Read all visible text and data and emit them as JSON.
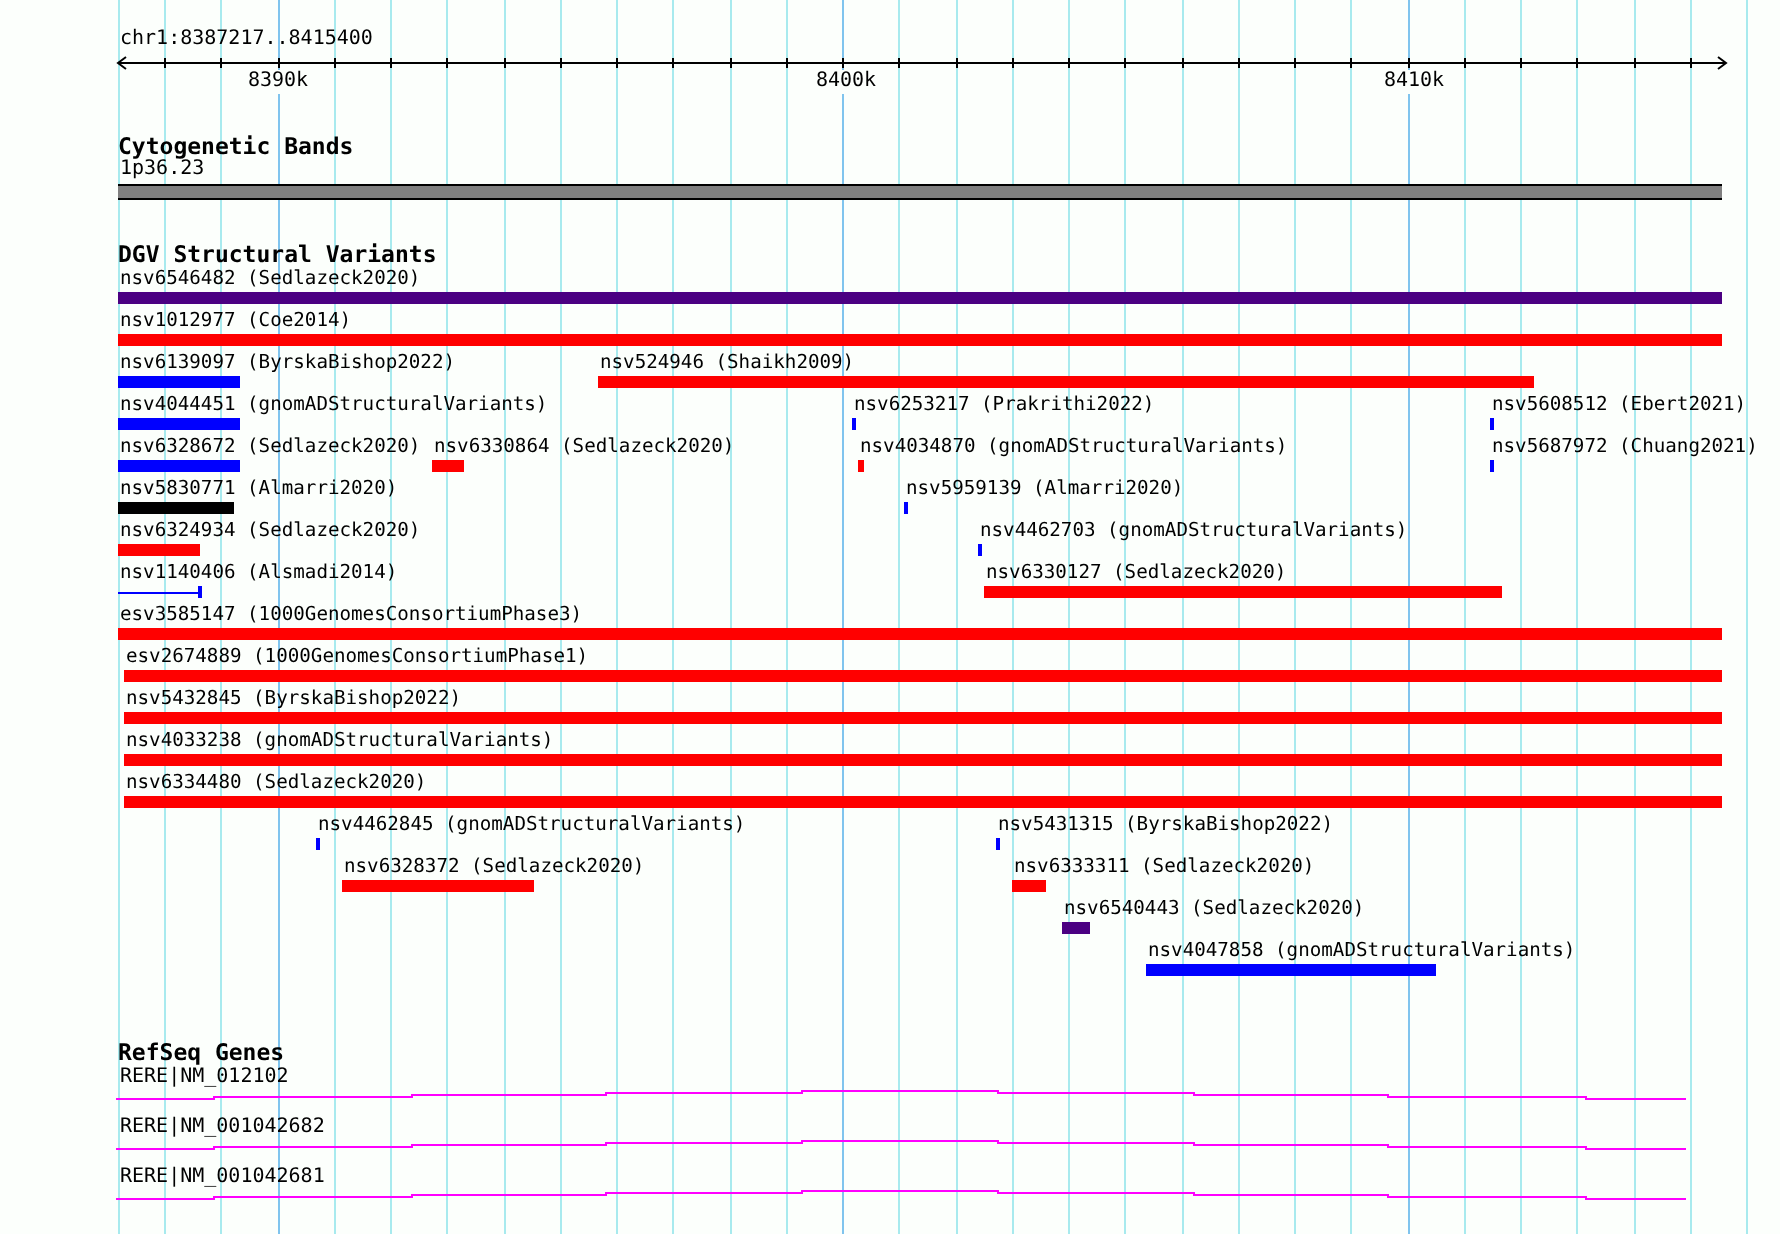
{
  "axis": {
    "location": "chr1:8387217..8415400",
    "ticks": [
      "8390k",
      "8400k",
      "8410k"
    ]
  },
  "tracks": [
    {
      "kind": "bands",
      "title": "Cytogenetic Bands",
      "features": [
        {
          "label": "1p36.23",
          "color": "#808080"
        }
      ]
    },
    {
      "kind": "variants",
      "title": "DGV Structural Variants",
      "features": [
        {
          "label": "nsv6546482 (Sedlazeck2020)",
          "color": "#4b0082",
          "kind": "bar"
        },
        {
          "label": "nsv1012977 (Coe2014)",
          "color": "#ff0000",
          "kind": "bar"
        },
        {
          "label": "nsv6139097 (ByrskaBishop2022)",
          "color": "#0000ff",
          "kind": "bar"
        },
        {
          "label": "nsv524946 (Shaikh2009)",
          "color": "#ff0000",
          "kind": "bar"
        },
        {
          "label": "nsv4044451 (gnomADStructuralVariants)",
          "color": "#0000ff",
          "kind": "bar"
        },
        {
          "label": "nsv6253217 (Prakrithi2022)",
          "color": "#0000ff",
          "kind": "bar"
        },
        {
          "label": "nsv5608512 (Ebert2021)",
          "color": "#0000ff",
          "kind": "bar"
        },
        {
          "label": "nsv6328672 (Sedlazeck2020)",
          "color": "#0000ff",
          "kind": "bar"
        },
        {
          "label": "nsv6330864 (Sedlazeck2020)",
          "color": "#ff0000",
          "kind": "bar"
        },
        {
          "label": "nsv4034870 (gnomADStructuralVariants)",
          "color": "#ff0000",
          "kind": "bar"
        },
        {
          "label": "nsv5687972 (Chuang2021)",
          "color": "#0000ff",
          "kind": "bar"
        },
        {
          "label": "nsv5830771 (Almarri2020)",
          "color": "#000000",
          "kind": "bar"
        },
        {
          "label": "nsv5959139 (Almarri2020)",
          "color": "#0000ff",
          "kind": "bar"
        },
        {
          "label": "nsv6324934 (Sedlazeck2020)",
          "color": "#ff0000",
          "kind": "bar"
        },
        {
          "label": "nsv4462703 (gnomADStructuralVariants)",
          "color": "#0000ff",
          "kind": "bar"
        },
        {
          "label": "nsv1140406 (Alsmadi2014)",
          "color": "#0000ff",
          "kind": "line"
        },
        {
          "label": "nsv6330127 (Sedlazeck2020)",
          "color": "#ff0000",
          "kind": "bar"
        },
        {
          "label": "esv3585147 (1000GenomesConsortiumPhase3)",
          "color": "#ff0000",
          "kind": "bar"
        },
        {
          "label": "esv2674889 (1000GenomesConsortiumPhase1)",
          "color": "#ff0000",
          "kind": "bar"
        },
        {
          "label": "nsv5432845 (ByrskaBishop2022)",
          "color": "#ff0000",
          "kind": "bar"
        },
        {
          "label": "nsv4033238 (gnomADStructuralVariants)",
          "color": "#ff0000",
          "kind": "bar"
        },
        {
          "label": "nsv6334480 (Sedlazeck2020)",
          "color": "#ff0000",
          "kind": "bar"
        },
        {
          "label": "nsv4462845 (gnomADStructuralVariants)",
          "color": "#0000ff",
          "kind": "bar"
        },
        {
          "label": "nsv5431315 (ByrskaBishop2022)",
          "color": "#0000ff",
          "kind": "bar"
        },
        {
          "label": "nsv6328372 (Sedlazeck2020)",
          "color": "#ff0000",
          "kind": "bar"
        },
        {
          "label": "nsv6333311 (Sedlazeck2020)",
          "color": "#ff0000",
          "kind": "bar"
        },
        {
          "label": "nsv6540443 (Sedlazeck2020)",
          "color": "#4b0082",
          "kind": "bar"
        },
        {
          "label": "nsv4047858 (gnomADStructuralVariants)",
          "color": "#0000ff",
          "kind": "bar"
        }
      ]
    },
    {
      "kind": "genes",
      "title": "RefSeq Genes",
      "features": [
        {
          "label": "RERE|NM_012102"
        },
        {
          "label": "RERE|NM_001042682"
        },
        {
          "label": "RERE|NM_001042681"
        }
      ]
    }
  ]
}
